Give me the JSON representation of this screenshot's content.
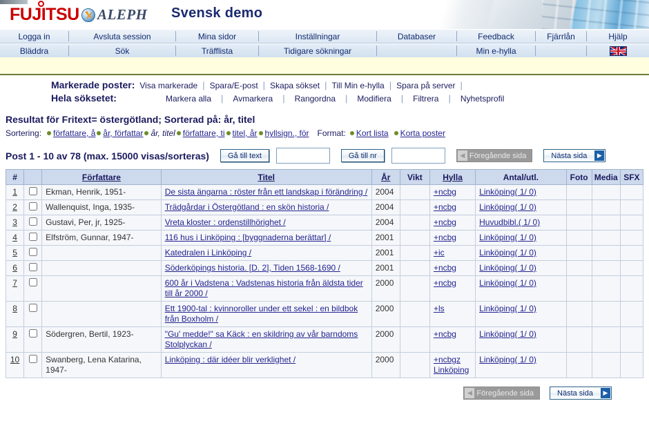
{
  "banner": {
    "fujitsu_logo": "FUJITSU",
    "aleph_logo": "ALEPH",
    "title": "Svensk demo"
  },
  "nav": {
    "row1": [
      "Logga in",
      "Avsluta session",
      "Mina sidor",
      "Inställningar",
      "Databaser",
      "Feedback",
      "Fjärrlån",
      "Hjälp"
    ],
    "row2": [
      "Bläddra",
      "Sök",
      "Träfflista",
      "Tidigare sökningar",
      "",
      "Min e-hylla",
      ""
    ],
    "flag": "uk-flag-icon"
  },
  "actions": {
    "marked_label": "Markerade poster:",
    "marked_items": [
      "Visa markerade",
      "Spara/E-post",
      "Skapa sökset",
      "Till Min e-hylla",
      "Spara på server"
    ],
    "all_label": "Hela söksetet:",
    "all_items": [
      "Markera alla",
      "Avmarkera",
      "Rangordna",
      "Modifiera",
      "Filtrera",
      "Nyhetsprofil"
    ]
  },
  "result": {
    "heading": "Resultat för Fritext= östergötland;  Sorterad på: år, titel",
    "sorting_label": "Sortering:",
    "sort_options": [
      {
        "label": "författare, å",
        "current": false
      },
      {
        "label": "år, författar",
        "current": false
      },
      {
        "label": "år, titel",
        "current": true
      },
      {
        "label": "författare, ti",
        "current": false
      },
      {
        "label": "titel, år",
        "current": false
      },
      {
        "label": "hyllsign., för",
        "current": false
      }
    ],
    "format_label": "Format:",
    "format_options": [
      "Kort lista",
      "Korta poster"
    ]
  },
  "paging": {
    "post_count": "Post 1 - 10 av 78 (max. 15000 visas/sorteras)",
    "goto_text_button": "Gå till text",
    "goto_text_value": "",
    "goto_nr_button": "Gå till nr",
    "goto_nr_value": "",
    "prev_label": "Föregående sida",
    "next_label": "Nästa sida",
    "prev_arrow": "◀",
    "next_arrow": "▶"
  },
  "table": {
    "headers": [
      "#",
      "",
      "Författare",
      "Titel",
      "År",
      "Vikt",
      "Hylla",
      "Antal/utl.",
      "Foto",
      "Media",
      "SFX"
    ],
    "rows": [
      {
        "num": "1",
        "author": "Ekman, Henrik, 1951-",
        "title": "De sista ängarna : röster från ett landskap i förändring /",
        "year": "2004",
        "vikt": "",
        "hylla": "+ncbg",
        "hylla2": "",
        "antal": "Linköping( 1/ 0)",
        "foto": "",
        "media": "",
        "sfx": ""
      },
      {
        "num": "2",
        "author": "Wallenquist, Inga, 1935-",
        "title": "Trädgårdar i Östergötland : en skön historia /",
        "year": "2004",
        "vikt": "",
        "hylla": "+ncbg",
        "hylla2": "",
        "antal": "Linköping( 1/ 0)",
        "foto": "",
        "media": "",
        "sfx": ""
      },
      {
        "num": "3",
        "author": "Gustavi, Per, jr, 1925-",
        "title": "Vreta kloster : ordenstillhörighet /",
        "year": "2004",
        "vikt": "",
        "hylla": "+ncbg",
        "hylla2": "",
        "antal": "Huvudbibl.( 1/ 0)",
        "foto": "",
        "media": "",
        "sfx": ""
      },
      {
        "num": "4",
        "author": "Elfström, Gunnar, 1947-",
        "title": "116 hus i Linköping : [byggnaderna berättar] /",
        "year": "2001",
        "vikt": "",
        "hylla": "+ncbg",
        "hylla2": "",
        "antal": "Linköping( 1/ 0)",
        "foto": "",
        "media": "",
        "sfx": ""
      },
      {
        "num": "5",
        "author": "",
        "title": "Katedralen i Linköping /",
        "year": "2001",
        "vikt": "",
        "hylla": "+ic",
        "hylla2": "",
        "antal": "Linköping( 1/ 0)",
        "foto": "",
        "media": "",
        "sfx": ""
      },
      {
        "num": "6",
        "author": "",
        "title": "Söderköpings historia. [D. 2], Tiden 1568-1690 /",
        "year": "2001",
        "vikt": "",
        "hylla": "+ncbg",
        "hylla2": "",
        "antal": "Linköping( 1/ 0)",
        "foto": "",
        "media": "",
        "sfx": ""
      },
      {
        "num": "7",
        "author": "",
        "title": "600 år i Vadstena : Vadstenas historia från äldsta tider till år 2000 /",
        "year": "2000",
        "vikt": "",
        "hylla": "+ncbg",
        "hylla2": "",
        "antal": "Linköping( 1/ 0)",
        "foto": "",
        "media": "",
        "sfx": ""
      },
      {
        "num": "8",
        "author": "",
        "title": "Ett 1900-tal : kvinnoroller under ett sekel : en bildbok från Boxholm /",
        "year": "2000",
        "vikt": "",
        "hylla": "+ls",
        "hylla2": "",
        "antal": "Linköping( 1/ 0)",
        "foto": "",
        "media": "",
        "sfx": ""
      },
      {
        "num": "9",
        "author": "Södergren, Bertil, 1923-",
        "title": "\"Gu' medde!\" sa Käck : en skildring av vår barndoms Stolplyckan /",
        "year": "2000",
        "vikt": "",
        "hylla": "+ncbg",
        "hylla2": "",
        "antal": "Linköping( 1/ 0)",
        "foto": "",
        "media": "",
        "sfx": ""
      },
      {
        "num": "10",
        "author": "Swanberg, Lena Katarina, 1947-",
        "title": "Linköping : där idéer blir verklighet /",
        "year": "2000",
        "vikt": "",
        "hylla": "+ncbgz",
        "hylla2": "Linköping",
        "antal": "Linköping( 1/ 0)",
        "foto": "",
        "media": "",
        "sfx": ""
      }
    ]
  },
  "colors": {
    "fujitsu_red": "#cc0000",
    "title_blue": "#1a2a6e",
    "link_blue": "#24248f",
    "header_bg": "#cdd9ec",
    "band_yellow": "#ffffe0",
    "band_border": "#6b7a3a",
    "bullet_olive": "#6b8e23"
  }
}
